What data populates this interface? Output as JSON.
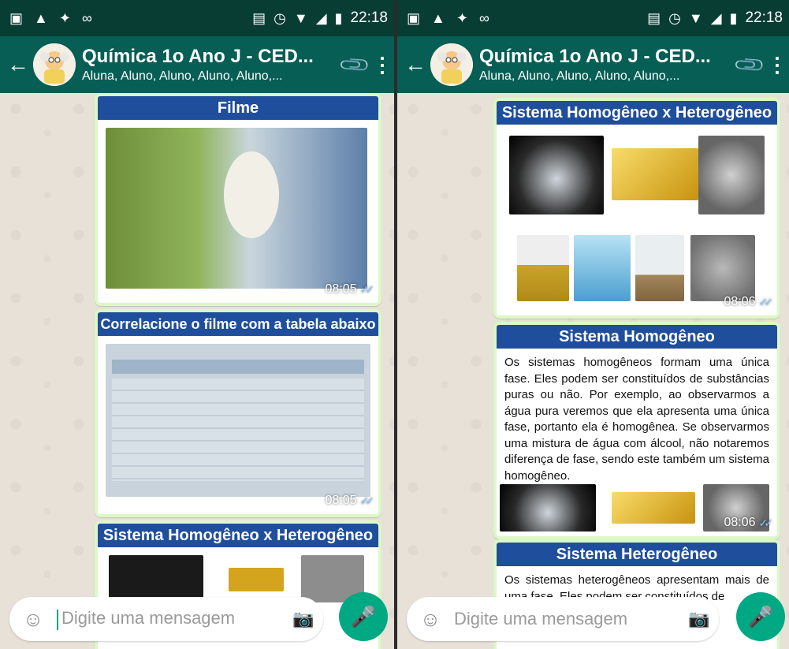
{
  "status": {
    "time": "22:18"
  },
  "chat": {
    "title": "Química 1o Ano J - CED...",
    "subtitle": "Aluna, Aluno, Aluno, Aluno, Aluno,..."
  },
  "left": {
    "messages": [
      {
        "slide_title": "Filme",
        "time": "08:05"
      },
      {
        "slide_title": "Correlacione o filme com a tabela abaixo",
        "time": "08:05"
      },
      {
        "slide_title": "Sistema Homogêneo x Heterogêneo"
      }
    ]
  },
  "right": {
    "messages": [
      {
        "slide_title": "Sistema Homogêneo x Heterogêneo",
        "time": "08:06"
      },
      {
        "slide_title": "Sistema Homogêneo",
        "time": "08:06",
        "body": "Os sistemas homogêneos formam uma única fase. Eles podem ser constituídos de substâncias puras ou não. Por exemplo, ao observarmos a água pura veremos que ela apresenta uma única fase, portanto ela é homogênea. Se observarmos uma mistura de água com álcool, não notaremos diferença de fase, sendo este também um sistema homogêneo."
      },
      {
        "slide_title": "Sistema Heterogêneo",
        "body": "Os sistemas heterogêneos apresentam mais de uma fase. Eles podem ser constituídos de"
      }
    ]
  },
  "composer": {
    "placeholder": "Digite uma mensagem"
  },
  "colors": {
    "statusbar": "#083d34",
    "appbar": "#075e54",
    "bubble": "#dcf8c6",
    "slide_header": "#1f4e9c",
    "mic": "#00a884"
  }
}
